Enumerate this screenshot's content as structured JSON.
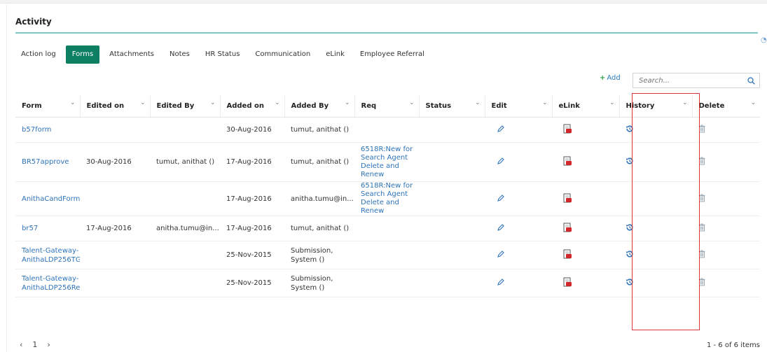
{
  "section": {
    "title": "Activity"
  },
  "tabs": [
    {
      "label": "Action log"
    },
    {
      "label": "Forms"
    },
    {
      "label": "Attachments"
    },
    {
      "label": "Notes"
    },
    {
      "label": "HR Status"
    },
    {
      "label": "Communication"
    },
    {
      "label": "eLink"
    },
    {
      "label": "Employee Referral"
    }
  ],
  "active_tab": "Forms",
  "toolbar": {
    "add_label": "Add",
    "search_placeholder": "Search..."
  },
  "table": {
    "columns": [
      "Form",
      "Edited on",
      "Edited By",
      "Added on",
      "Added By",
      "Req",
      "Status",
      "Edit",
      "eLink",
      "History",
      "Delete"
    ],
    "rows": [
      {
        "form": "b57form",
        "edited_on": "",
        "edited_by": "",
        "added_on": "30-Aug-2016",
        "added_by": "tumut, anithat ()",
        "req": "",
        "status": "",
        "has_history": true
      },
      {
        "form": "BR57approve",
        "edited_on": "30-Aug-2016",
        "edited_by": "tumut, anithat ()",
        "added_on": "17-Aug-2016",
        "added_by": "tumut, anithat ()",
        "req": "6518R:New for Search Agent Delete and Renew",
        "status": "",
        "has_history": true
      },
      {
        "form": "AnithaCandForm...",
        "edited_on": "",
        "edited_by": "",
        "added_on": "17-Aug-2016",
        "added_by": "anitha.tumu@in...",
        "req": "6518R:New for Search Agent Delete and Renew",
        "status": "",
        "has_history": false
      },
      {
        "form": "br57",
        "edited_on": "17-Aug-2016",
        "edited_by": "anitha.tumu@in...",
        "added_on": "17-Aug-2016",
        "added_by": "tumut, anithat ()",
        "req": "",
        "status": "",
        "has_history": true
      },
      {
        "form": "Talent-Gateway-AnithaLDP256TG",
        "edited_on": "",
        "edited_by": "",
        "added_on": "25-Nov-2015",
        "added_by": "Submission, System ()",
        "req": "",
        "status": "",
        "has_history": true
      },
      {
        "form": "Talent-Gateway-AnithaLDP256Re...",
        "edited_on": "",
        "edited_by": "",
        "added_on": "25-Nov-2015",
        "added_by": "Submission, System ()",
        "req": "",
        "status": "",
        "has_history": true
      }
    ]
  },
  "pagination": {
    "prev": "‹",
    "page": "1",
    "next": "›",
    "info": "1 - 6 of 6 items"
  },
  "colors": {
    "accent": "#0d7f63",
    "link": "#2f73b8",
    "highlight": "#d9383a",
    "rule": "#7fc7c4"
  },
  "icons": {
    "edit": "pencil-icon",
    "elink": "pdf-document-icon",
    "history": "history-icon",
    "delete": "trash-icon",
    "search": "search-icon",
    "add": "plus-icon"
  }
}
